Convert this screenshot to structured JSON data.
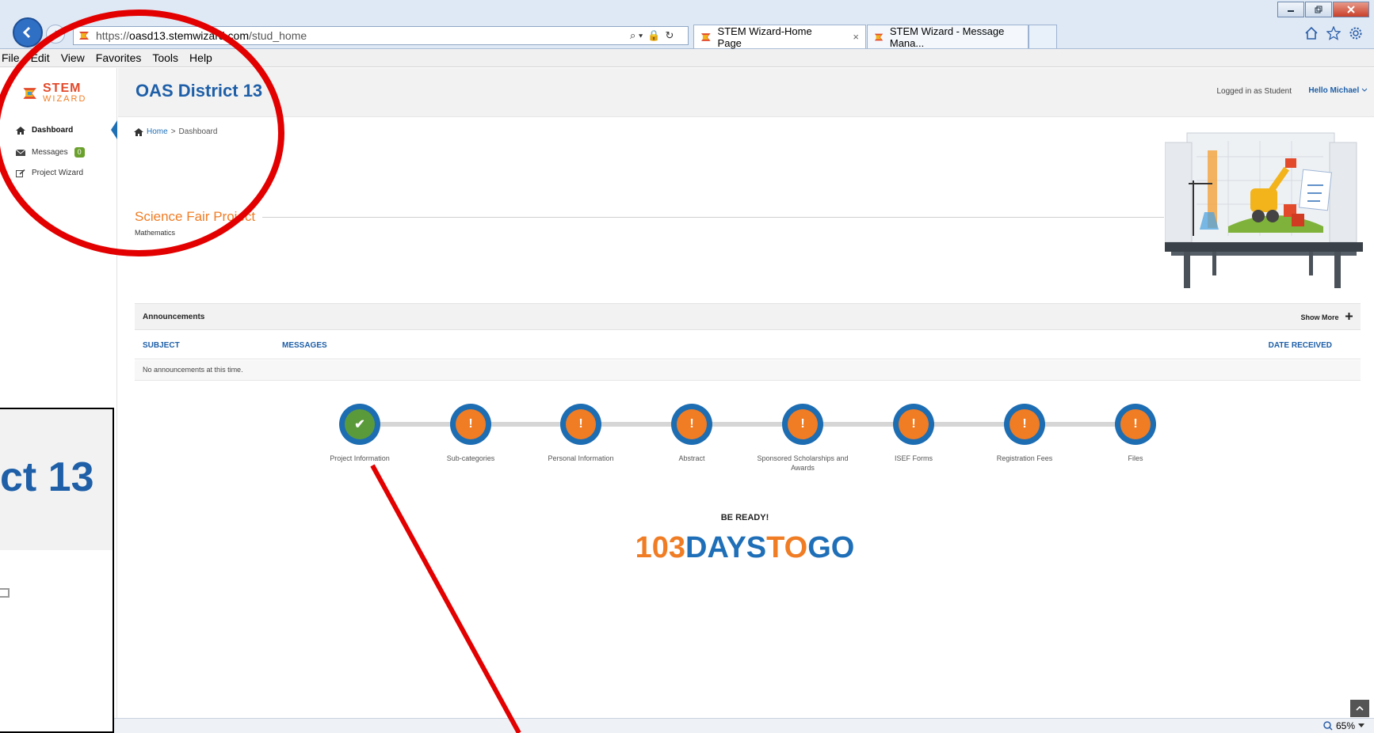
{
  "browser": {
    "url_prefix": "https://",
    "url_host": "oasd13.stemwizard.com",
    "url_path": "/stud_home",
    "tabs": [
      {
        "label": "STEM Wizard-Home Page",
        "active": true,
        "close": "×"
      },
      {
        "label": "STEM Wizard - Message Mana..."
      }
    ],
    "search_glyph": "⌕ ▾",
    "lock_glyph": "🔒",
    "refresh_glyph": "↻"
  },
  "menu": [
    "File",
    "Edit",
    "View",
    "Favorites",
    "Tools",
    "Help"
  ],
  "logo": {
    "line1": "STEM",
    "line2": "WIZARD"
  },
  "sidebar": {
    "items": [
      {
        "label": "Dashboard",
        "icon": "home-icon",
        "active": true
      },
      {
        "label": "Messages",
        "icon": "envelope-icon",
        "badge": "0"
      },
      {
        "label": "Project Wizard",
        "icon": "edit-icon"
      }
    ]
  },
  "header": {
    "title": "OAS District 13",
    "logged_in": "Logged in as Student",
    "hello": "Hello Michael"
  },
  "breadcrumb": {
    "home": "Home",
    "sep": ">",
    "current": "Dashboard"
  },
  "project": {
    "title": "Science Fair Project",
    "category": "Mathematics"
  },
  "announcements": {
    "label": "Announcements",
    "show_more": "Show More",
    "columns": {
      "subject": "SUBJECT",
      "messages": "MESSAGES",
      "date": "DATE RECEIVED"
    },
    "empty": "No announcements at this time."
  },
  "steps": [
    {
      "label": "Project Information",
      "status": "done"
    },
    {
      "label": "Sub-categories",
      "status": "todo"
    },
    {
      "label": "Personal Information",
      "status": "todo"
    },
    {
      "label": "Abstract",
      "status": "todo"
    },
    {
      "label": "Sponsored Scholarships and Awards",
      "status": "todo"
    },
    {
      "label": "ISEF Forms",
      "status": "todo"
    },
    {
      "label": "Registration Fees",
      "status": "todo"
    },
    {
      "label": "Files",
      "status": "todo"
    }
  ],
  "step_glyphs": {
    "done": "✔",
    "todo": "!"
  },
  "countdown": {
    "ready": "BE READY!",
    "days": "103",
    "days_word": "DAYS",
    "to": "TO",
    "go": "GO"
  },
  "status": {
    "zoom": "65%"
  },
  "inset": {
    "zoomed_title": "ct 13"
  },
  "colors": {
    "accent_blue": "#1e5fa8",
    "accent_orange": "#f07c24",
    "done_green": "#5b9a3a",
    "annotation_red": "#e30000"
  }
}
